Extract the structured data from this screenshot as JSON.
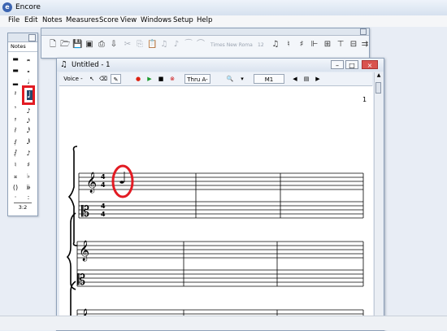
{
  "app": {
    "title": "Encore",
    "icon_glyph": "e"
  },
  "menu": [
    "File",
    "Edit",
    "Notes",
    "Measures",
    "Score",
    "View",
    "Windows",
    "Setup",
    "Help"
  ],
  "palette": {
    "tab_label": "Notes",
    "tuplet_label": "3:2",
    "selected_tool": "quarter-note"
  },
  "toolbar": {
    "font_name": "Times New Roma",
    "font_size": "12"
  },
  "document": {
    "title": "Untitled - 1",
    "voice_label": "Voice -",
    "thru_label": "Thru A-",
    "measure_label": "M1",
    "page_number": "1"
  },
  "colors": {
    "highlight_red": "#e21b23",
    "selected_note_bg": "#27486b"
  }
}
